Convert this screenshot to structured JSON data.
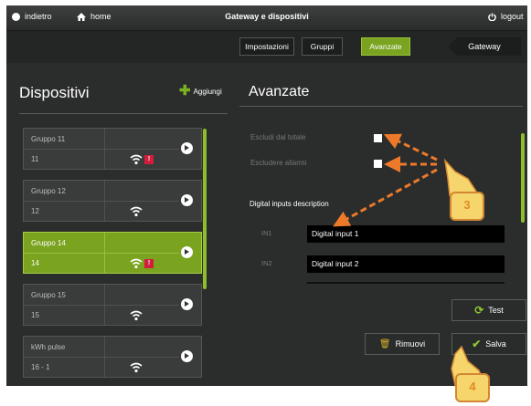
{
  "topbar": {
    "back_label": "indietro",
    "home_label": "home",
    "title": "Gateway e dispositivi",
    "logout_label": "logout"
  },
  "nav": {
    "tabs": [
      "Impostazioni",
      "Gruppi",
      "Avanzate"
    ],
    "active_tab": "Avanzate",
    "gateway_label": "Gateway"
  },
  "left": {
    "title": "Dispositivi",
    "add_label": "Aggiungi",
    "devices": [
      {
        "name": "Gruppo 11",
        "num": "11",
        "badge": "!"
      },
      {
        "name": "Gruppo 12",
        "num": "12"
      },
      {
        "name": "Gruppo 14",
        "num": "14",
        "badge": "!"
      },
      {
        "name": "Gruppo 15",
        "num": "15"
      },
      {
        "name": "kWh pulse",
        "num": "16 - 1"
      }
    ]
  },
  "right": {
    "title": "Avanzate",
    "options": [
      "Escludi dal totale",
      "Escludere allarmi"
    ],
    "inputs_heading": "Digital inputs description",
    "inputs": [
      {
        "label": "IN1",
        "value": "Digital input 1"
      },
      {
        "label": "IN2",
        "value": "Digital input 2"
      }
    ],
    "buttons": {
      "test": "Test",
      "remove": "Rimuovi",
      "save": "Salva"
    }
  },
  "annotations": [
    "3",
    "4"
  ],
  "colors": {
    "accent": "#7aa31f",
    "background": "#2b2c2c",
    "alert": "#d21d3d",
    "callout_arrow": "#ec7a2a"
  }
}
